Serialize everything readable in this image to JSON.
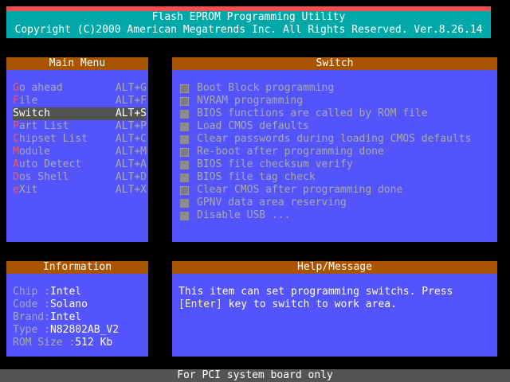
{
  "banner": {
    "title": "Flash EPROM Programming Utility",
    "copyright": "Copyright (C)2000 American Megatrends Inc. All Rights Reserved. Ver.8.26.14"
  },
  "main_menu": {
    "title": "Main Menu",
    "items": [
      {
        "hot": "G",
        "rest": "o ahead",
        "shortcut": "ALT+G"
      },
      {
        "hot": "F",
        "rest": "ile",
        "shortcut": "ALT+F"
      },
      {
        "hot": "S",
        "rest": "witch",
        "shortcut": "ALT+S"
      },
      {
        "hot": "P",
        "rest": "art List",
        "shortcut": "ALT+P"
      },
      {
        "hot": "C",
        "rest": "hipset List",
        "shortcut": "ALT+C"
      },
      {
        "hot": "M",
        "rest": "odule",
        "shortcut": "ALT+M"
      },
      {
        "hot": "A",
        "rest": "uto Detect",
        "shortcut": "ALT+A"
      },
      {
        "hot": "D",
        "rest": "os Shell",
        "shortcut": "ALT+D"
      },
      {
        "hot": "e",
        "rest": "Xit",
        "shortcut": "ALT+X"
      }
    ],
    "selected_label": "Switch"
  },
  "switch_panel": {
    "title": "Switch",
    "items": [
      {
        "label": "Boot Block programming",
        "checked": true
      },
      {
        "label": "NVRAM programming",
        "checked": true
      },
      {
        "label": "BIOS functions are called by ROM file",
        "checked": false
      },
      {
        "label": "Load CMOS defaults",
        "checked": false
      },
      {
        "label": "Clear passwords during loading CMOS defaults",
        "checked": false
      },
      {
        "label": "Re-boot after programming done",
        "checked": true
      },
      {
        "label": "BIOS file checksum verify",
        "checked": false
      },
      {
        "label": "BIOS file tag check",
        "checked": false
      },
      {
        "label": "Clear CMOS after programming done",
        "checked": true
      },
      {
        "label": "GPNV data area reserving",
        "checked": false
      },
      {
        "label": "Disable USB ...",
        "checked": false
      }
    ]
  },
  "information": {
    "title": "Information",
    "rows": [
      {
        "label": "Chip ",
        "value": "Intel"
      },
      {
        "label": "Code ",
        "value": "Solano"
      },
      {
        "label": "Brand",
        "value": "Intel"
      },
      {
        "label": "Type ",
        "value": "N82802AB_V2"
      },
      {
        "label": "ROM Size ",
        "value": "512 Kb"
      }
    ]
  },
  "help": {
    "title": "Help/Message",
    "line1": "This item can set programming switchs. Press",
    "line2_key": "[Enter]",
    "line2_rest": " key to switch to work area."
  },
  "status_bar": {
    "text": "For PCI system board only"
  },
  "colors": {
    "panel_bg": "#5454fc",
    "header_bg": "#a85400",
    "banner_bg": "#00a8a8",
    "banner_accent": "#f05050",
    "hotkey": "#fc5454",
    "highlight": "#fcfc54",
    "selection_bg": "#545454"
  }
}
